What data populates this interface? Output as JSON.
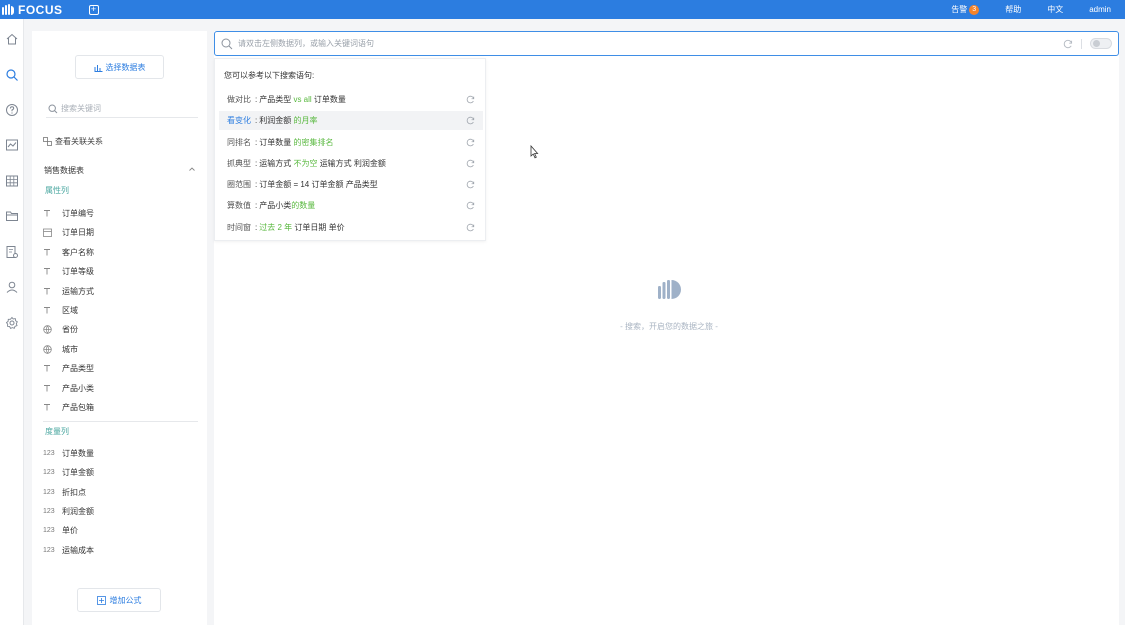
{
  "topbar": {
    "logo_text": "FOCUS",
    "new_tab_label": "+",
    "alerts_label": "告警",
    "alerts_count": "3",
    "help_label": "帮助",
    "language_label": "中文",
    "user_label": "admin"
  },
  "rail": {
    "icons": [
      "home-icon",
      "search-icon",
      "help-icon",
      "dashboard-icon",
      "table-icon",
      "folder-icon",
      "data-settings-icon",
      "user-icon",
      "gear-icon"
    ]
  },
  "panel": {
    "select_table_label": "选择数据表",
    "search_placeholder": "搜索关键词",
    "view_relations_label": "查看关联关系",
    "table_name": "销售数据表",
    "attribute_section": "属性列",
    "attribute_fields": [
      {
        "type": "text",
        "name": "订单编号"
      },
      {
        "type": "date",
        "name": "订单日期"
      },
      {
        "type": "text",
        "name": "客户名称"
      },
      {
        "type": "text",
        "name": "订单等级"
      },
      {
        "type": "text",
        "name": "运输方式"
      },
      {
        "type": "text",
        "name": "区域"
      },
      {
        "type": "geo",
        "name": "省份"
      },
      {
        "type": "geo",
        "name": "城市"
      },
      {
        "type": "text",
        "name": "产品类型"
      },
      {
        "type": "text",
        "name": "产品小类"
      },
      {
        "type": "text",
        "name": "产品包箱"
      }
    ],
    "measure_section": "度量列",
    "measure_type_label": "123",
    "measure_fields": [
      "订单数量",
      "订单金额",
      "折扣点",
      "利润金额",
      "单价",
      "运输成本"
    ],
    "add_formula_label": "增加公式"
  },
  "search": {
    "placeholder": "请双击左侧数据列，或输入关键词语句"
  },
  "suggestions": {
    "title": "您可以参考以下搜索语句:",
    "items": [
      {
        "category": "做对比",
        "parts": [
          "产品类型",
          " vs all ",
          "订单数量"
        ]
      },
      {
        "category": "看变化",
        "parts": [
          "利润金额",
          " 的月",
          "率"
        ]
      },
      {
        "category": "同排名",
        "parts": [
          "订单数量",
          " 的密集排名",
          ""
        ]
      },
      {
        "category": "抓典型",
        "parts": [
          "运输方式",
          " 不为空 ",
          "运输方式 利润金额"
        ]
      },
      {
        "category": "圈范围",
        "parts": [
          "订单金额 = 14 订单金额 产品类型",
          "",
          ""
        ]
      },
      {
        "category": "算数值",
        "parts": [
          "产品小类",
          "的数量",
          ""
        ]
      },
      {
        "category": "时间窗",
        "parts": [
          "",
          "过去 2 年 ",
          "订单日期 单价"
        ]
      }
    ]
  },
  "empty_state": {
    "text": "- 搜索，开启您的数据之旅 -"
  },
  "colors": {
    "primary": "#2c7de0",
    "green": "#58b83e",
    "teal": "#4aa7a0",
    "badge": "#f5832a"
  }
}
